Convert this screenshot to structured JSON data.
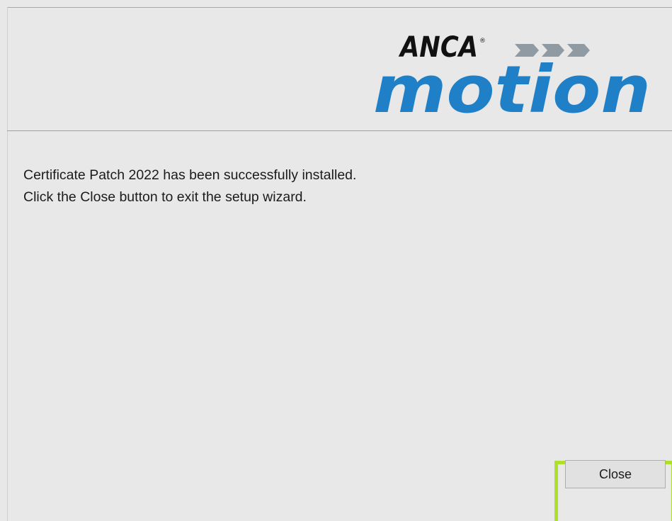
{
  "logo": {
    "brand_top": "ANCA",
    "brand_bottom": "motion",
    "brand_color": "#1f7fc7",
    "accent_color": "#8f9aa3"
  },
  "message": {
    "line1": "Certificate Patch 2022 has been successfully installed.",
    "line2": "Click the Close button to exit the setup wizard."
  },
  "footer": {
    "close_label": "Close",
    "highlight_color": "#aee02a"
  }
}
